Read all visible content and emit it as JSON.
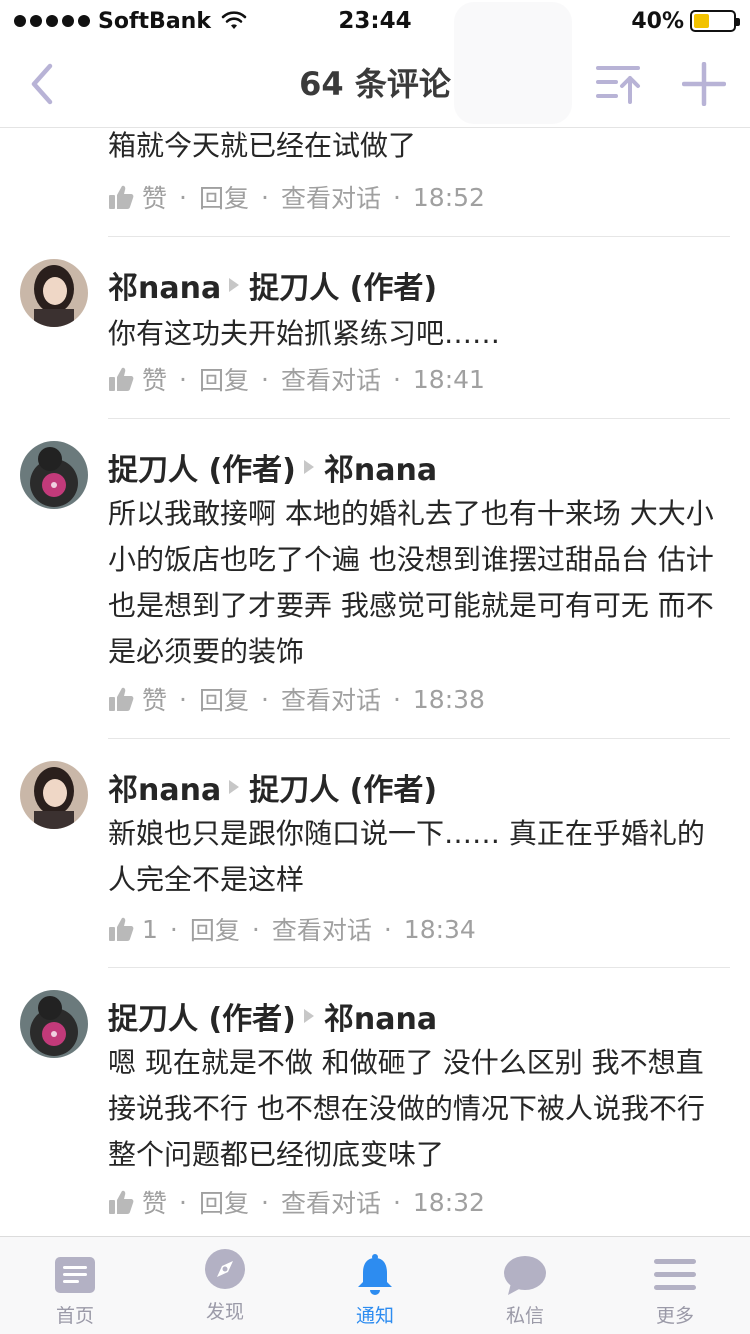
{
  "status_bar": {
    "carrier": "SoftBank",
    "time": "23:44",
    "battery": "40%",
    "battery_level": 0.4
  },
  "nav": {
    "title": "64 条评论",
    "back_icon": "chevron-left-icon",
    "sort_icon": "sort-icon",
    "add_icon": "plus-icon"
  },
  "comments": [
    {
      "text": "箱就今天就已经在试做了",
      "likes": "赞",
      "reply": "回复",
      "view_conversation": "查看对话",
      "time": "18:52"
    },
    {
      "author": "祁nana",
      "reply_to": "捉刀人 (作者)",
      "text": "你有这功夫开始抓紧练习吧……",
      "likes": "赞",
      "reply": "回复",
      "view_conversation": "查看对话",
      "time": "18:41"
    },
    {
      "author": "捉刀人 (作者)",
      "reply_to": "祁nana",
      "text": "所以我敢接啊 本地的婚礼去了也有十来场 大大小小的饭店也吃了个遍 也没想到谁摆过甜品台 估计也是想到了才要弄 我感觉可能就是可有可无 而不是必须要的装饰",
      "likes": "赞",
      "reply": "回复",
      "view_conversation": "查看对话",
      "time": "18:38"
    },
    {
      "author": "祁nana",
      "reply_to": "捉刀人 (作者)",
      "text": "新娘也只是跟你随口说一下…… 真正在乎婚礼的人完全不是这样",
      "likes": "1",
      "reply": "回复",
      "view_conversation": "查看对话",
      "time": "18:34"
    },
    {
      "author": "捉刀人 (作者)",
      "reply_to": "祁nana",
      "text": "嗯 现在就是不做 和做砸了 没什么区别 我不想直接说我不行 也不想在没做的情况下被人说我不行 整个问题都已经彻底变味了",
      "likes": "赞",
      "reply": "回复",
      "view_conversation": "查看对话",
      "time": "18:32"
    }
  ],
  "tabs": [
    {
      "label": "首页",
      "icon": "home-icon",
      "active": false
    },
    {
      "label": "发现",
      "icon": "compass-icon",
      "active": false
    },
    {
      "label": "通知",
      "icon": "bell-icon",
      "active": true
    },
    {
      "label": "私信",
      "icon": "chat-bubble-icon",
      "active": false
    },
    {
      "label": "更多",
      "icon": "menu-icon",
      "active": false
    }
  ],
  "colors": {
    "accent": "#2d8cf0",
    "nav_icon": "#b8b3d6",
    "tab_inactive": "#b3b1c4",
    "meta_text": "#a0a0a0"
  }
}
